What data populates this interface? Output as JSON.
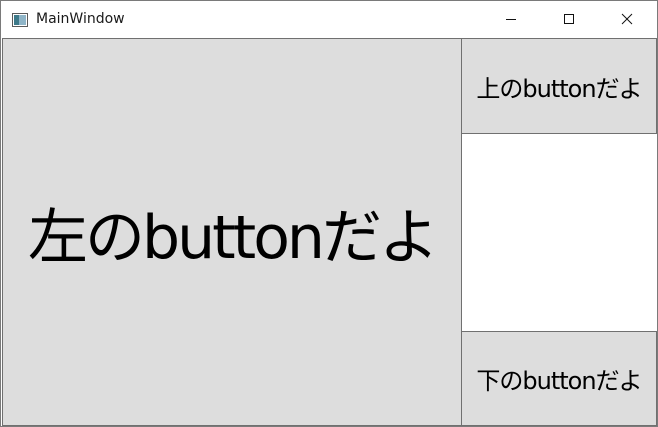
{
  "window": {
    "title": "MainWindow",
    "app_icon": "wpf-window-icon"
  },
  "caption_buttons": {
    "minimize_icon": "minimize-icon",
    "maximize_icon": "maximize-icon",
    "close_icon": "close-icon"
  },
  "buttons": {
    "left_label": "左のbuttonだよ",
    "top_label": "上のbuttonだよ",
    "bottom_label": "下のbuttonだよ"
  },
  "colors": {
    "button_face": "#dddddd",
    "button_border": "#707070",
    "background": "#ffffff"
  }
}
